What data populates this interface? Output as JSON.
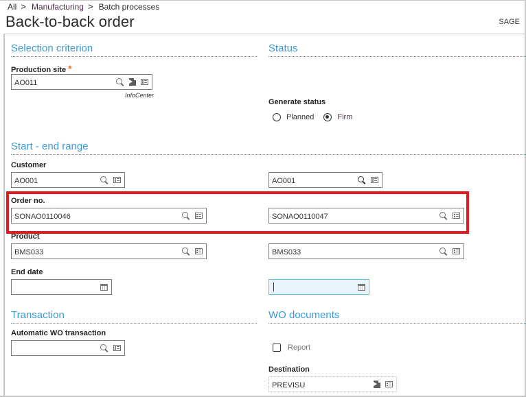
{
  "breadcrumb": {
    "items": [
      "All",
      "Manufacturing",
      "Batch processes"
    ],
    "separator": ">"
  },
  "header": {
    "title": "Back-to-back order",
    "user": "SAGE"
  },
  "sections": {
    "selection": {
      "title": "Selection criterion",
      "production_site": {
        "label": "Production site",
        "required_mark": "*",
        "value": "AO011",
        "infocenter_label": "InfoCenter"
      }
    },
    "status": {
      "title": "Status",
      "generate_status": {
        "label": "Generate status",
        "options": [
          "Planned",
          "Firm"
        ],
        "selected": "Firm"
      }
    },
    "range": {
      "title": "Start - end range",
      "customer": {
        "label": "Customer",
        "start": "AO001",
        "end": "AO001"
      },
      "order_no": {
        "label": "Order no.",
        "start": "SONAO0110046",
        "end": "SONAO0110047"
      },
      "product": {
        "label": "Product",
        "start": "BMS033",
        "end": "BMS033"
      },
      "end_date": {
        "label": "End date",
        "start": "",
        "end": ""
      }
    },
    "transaction": {
      "title": "Transaction",
      "automatic_wo": {
        "label": "Automatic WO transaction",
        "value": ""
      }
    },
    "wo_documents": {
      "title": "WO documents",
      "report": {
        "label": "Report",
        "checked": false
      },
      "destination": {
        "label": "Destination",
        "value": "PREVISU"
      }
    }
  },
  "annotation": {
    "highlight_color": "#e21b23",
    "highlighted_field": "Order no."
  },
  "colors": {
    "section_title": "#3a9ad9",
    "required": "#e8712a",
    "focused_field_bg": "#e9f5fb"
  }
}
